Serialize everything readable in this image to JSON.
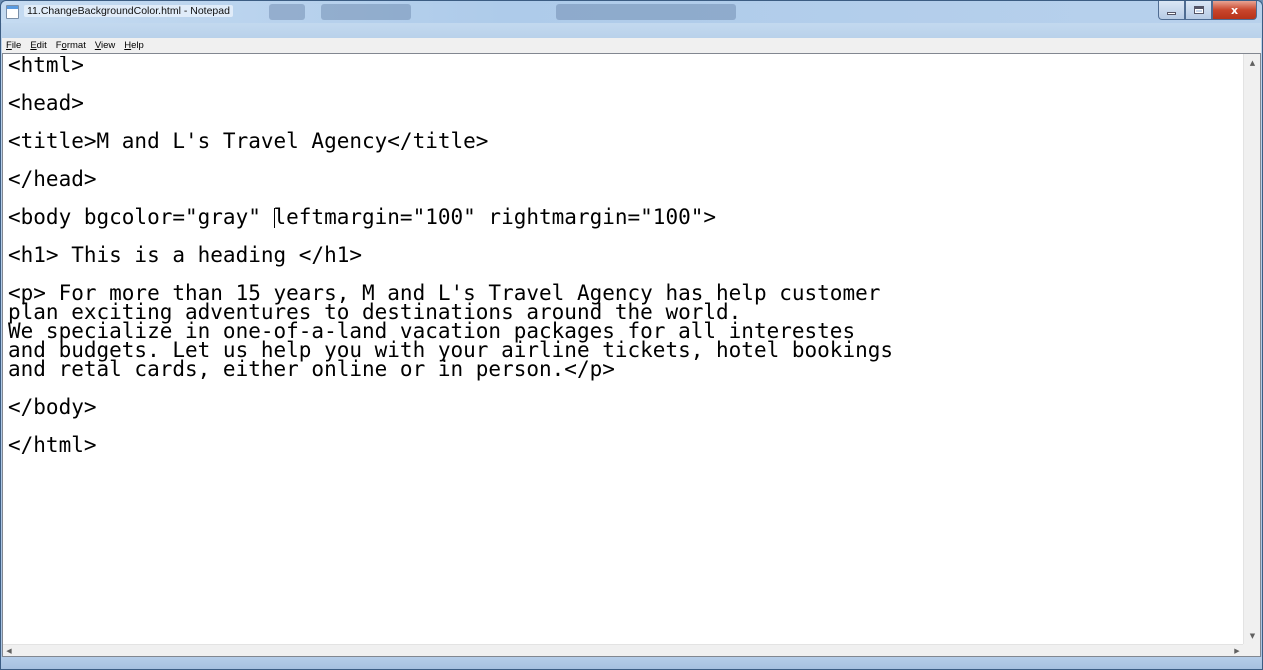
{
  "window": {
    "title": "11.ChangeBackgroundColor.html - Notepad",
    "controls": {
      "close_label": "x"
    }
  },
  "menubar": {
    "items": [
      {
        "label": "File",
        "accel": "F"
      },
      {
        "label": "Edit",
        "accel": "E"
      },
      {
        "label": "Format",
        "accel": "o"
      },
      {
        "label": "View",
        "accel": "V"
      },
      {
        "label": "Help",
        "accel": "H"
      }
    ]
  },
  "editor": {
    "lines": [
      "<html>",
      "",
      "<head>",
      "",
      "<title>M and L's Travel Agency</title>",
      "",
      "</head>",
      "",
      "<body bgcolor=\"gray\" leftmargin=\"100\" rightmargin=\"100\">",
      "",
      "<h1> This is a heading </h1>",
      "",
      "<p> For more than 15 years, M and L's Travel Agency has help customer",
      "plan exciting adventures to destinations around the world.",
      "We specialize in one-of-a-land vacation packages for all interestes",
      "and budgets. Let us help you with your airline tickets, hotel bookings",
      "and retal cards, either online or in person.</p>",
      "",
      "</body>",
      "",
      "</html>"
    ],
    "caret": {
      "line": 8,
      "column": 21
    }
  },
  "scrollbars": {
    "up_arrow": "▲",
    "down_arrow": "▼",
    "left_arrow": "◀",
    "right_arrow": "▶"
  }
}
